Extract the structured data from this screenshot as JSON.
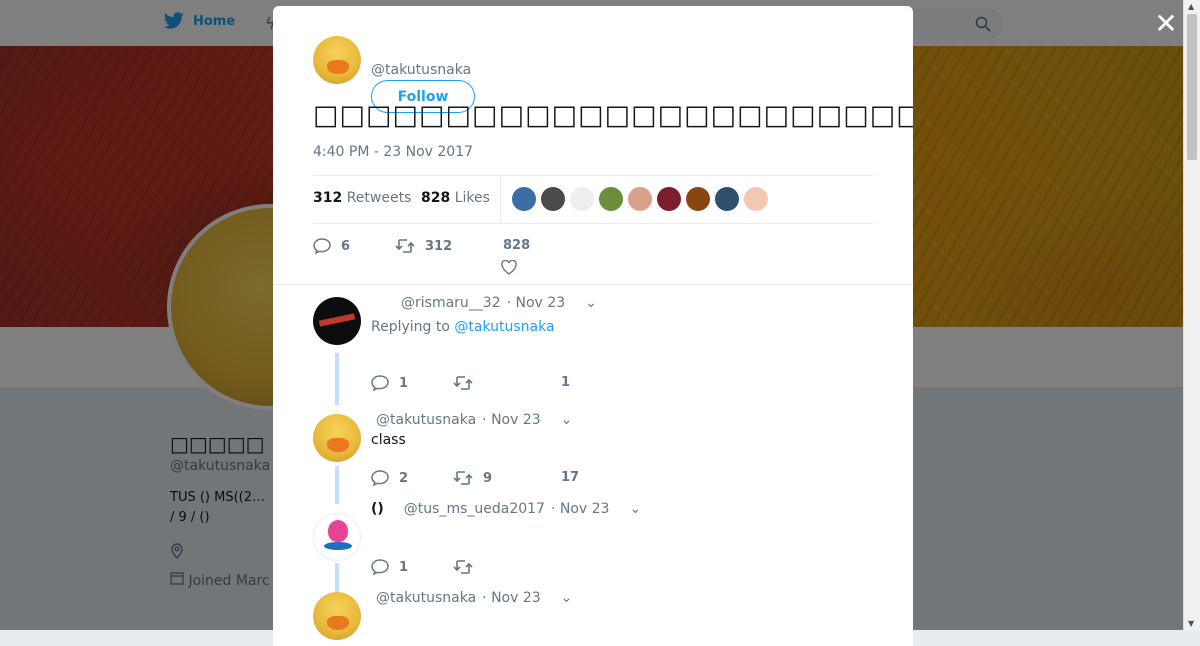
{
  "nav": {
    "home_label": "Home"
  },
  "profile": {
    "name": "□□□□□",
    "handle": "@takutusnaka",
    "bio_line1": "TUS () MS((2…",
    "bio_line2": " / 9 / ()",
    "joined": "Joined Marc"
  },
  "modal": {
    "close_label": "✕",
    "author_handle": "@takutusnaka",
    "follow_label": "Follow",
    "tweet_text": "□□□□□□□□□□□□□□□□□□□□□□□□□□□□",
    "timestamp": "4:40 PM - 23 Nov 2017",
    "retweets_count": "312",
    "retweets_label": "Retweets",
    "likes_count": "828",
    "likes_label": "Likes",
    "likers": [
      "#3b6ea5",
      "#4a4a4a",
      "#eeeeee",
      "#6b8e3a",
      "#d9a08b",
      "#7a1f2b",
      "#8b4513",
      "#2f4f6f",
      "#f2c9b0"
    ],
    "actions": {
      "replies": "6",
      "retweets": "312",
      "likes": "828"
    }
  },
  "replies": [
    {
      "handle": "@rismaru__32",
      "date": "· Nov 23",
      "replying_prefix": "Replying to",
      "replying_to": "@takutusnaka",
      "replies": "1",
      "retweets": "",
      "likes": "1"
    },
    {
      "handle": "@takutusnaka",
      "date": "· Nov 23",
      "text": "class",
      "replies": "2",
      "retweets": "9",
      "likes": "17"
    },
    {
      "display_name": "()",
      "handle": "@tus_ms_ueda2017",
      "date": "· Nov 23",
      "replies": "1",
      "retweets": "",
      "likes": ""
    },
    {
      "handle": "@takutusnaka",
      "date": "· Nov 23"
    }
  ],
  "colors": {
    "accent": "#1da1f2",
    "secondary_text": "#657786",
    "thread_line": "#c4e0f7"
  }
}
